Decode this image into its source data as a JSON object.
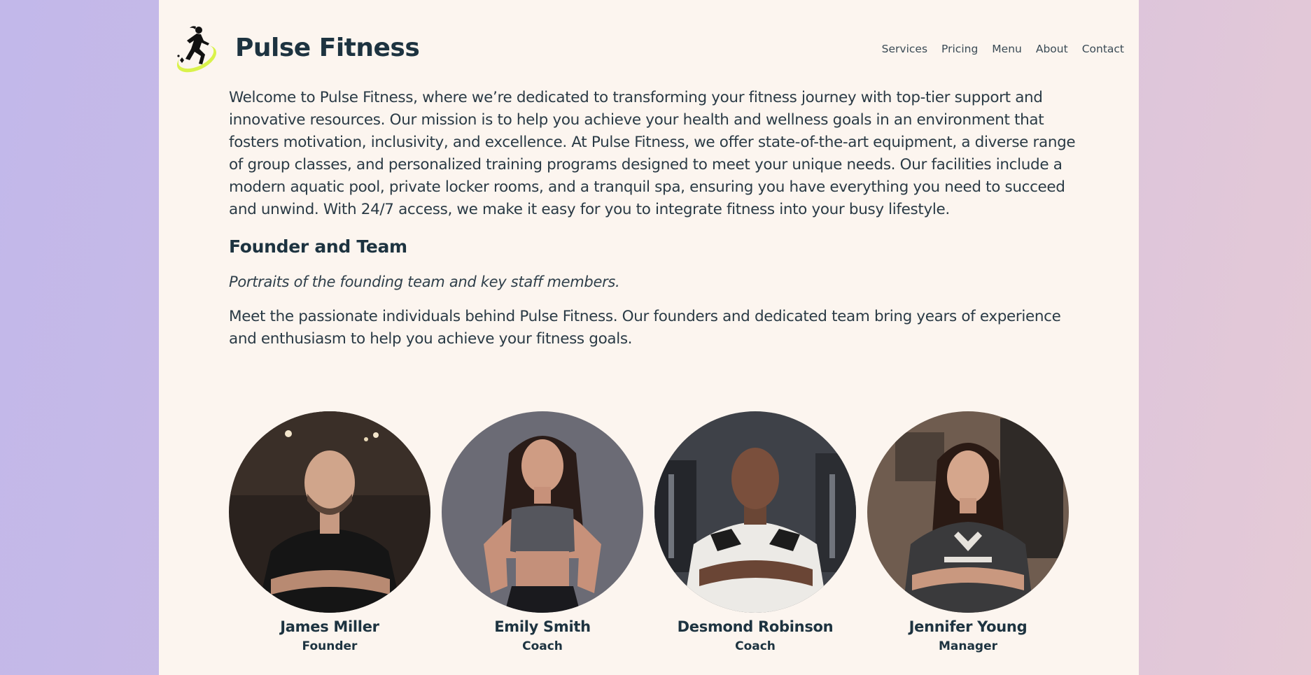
{
  "header": {
    "brand": "Pulse Fitness",
    "logo_icon": "runner-logo-icon",
    "nav": [
      {
        "label": "Services"
      },
      {
        "label": "Pricing"
      },
      {
        "label": "Menu"
      },
      {
        "label": "About"
      },
      {
        "label": "Contact"
      }
    ]
  },
  "main": {
    "intro": "Welcome to Pulse Fitness, where we’re dedicated to transforming your fitness journey with top-tier support and innovative resources. Our mission is to help you achieve your health and wellness goals in an environment that fosters motivation, inclusivity, and excellence. At Pulse Fitness, we offer state-of-the-art equipment, a diverse range of group classes, and personalized training programs designed to meet your unique needs. Our facilities include a modern aquatic pool, private locker rooms, and a tranquil spa, ensuring you have everything you need to succeed and unwind. With 24/7 access, we make it easy for you to integrate fitness into your busy lifestyle.",
    "section_title": "Founder and Team",
    "caption": "Portraits of the founding team and key staff members.",
    "team_description": "Meet the passionate individuals behind Pulse Fitness. Our founders and dedicated team bring years of experience and enthusiasm to help you achieve your fitness goals."
  },
  "team": [
    {
      "name": "James Miller",
      "role": "Founder"
    },
    {
      "name": "Emily Smith",
      "role": "Coach"
    },
    {
      "name": "Desmond Robinson",
      "role": "Coach"
    },
    {
      "name": "Jennifer Young",
      "role": "Manager"
    }
  ],
  "colors": {
    "page_background": "#fcf5ef",
    "text_dark": "#1d3340",
    "logo_accent": "#d9f24a"
  }
}
